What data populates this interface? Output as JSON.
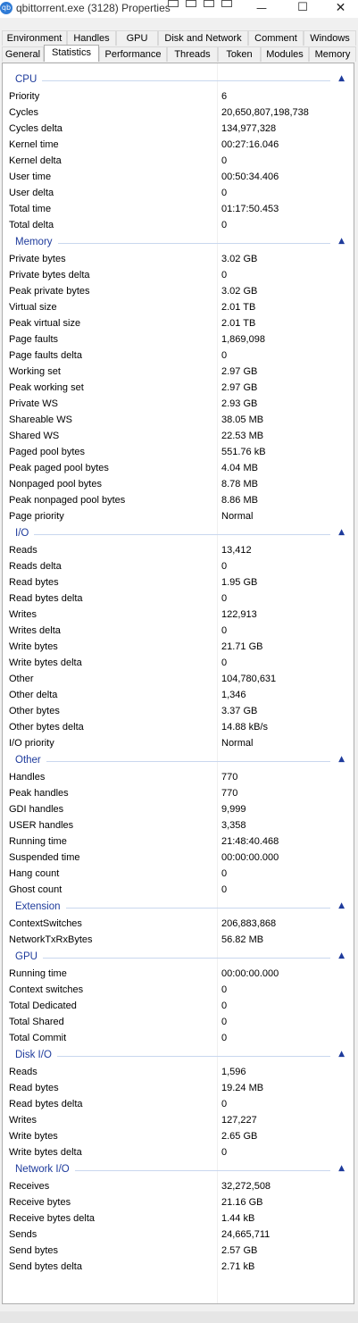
{
  "window": {
    "title": "qbittorrent.exe (3128) Properties",
    "minimize_glyph": "—",
    "maximize_glyph": "☐",
    "close_glyph": "✕"
  },
  "tabs": {
    "row1": [
      "Environment",
      "Handles",
      "GPU",
      "Disk and Network",
      "Comment",
      "Windows"
    ],
    "row2": [
      "General",
      "Statistics",
      "Performance",
      "Threads",
      "Token",
      "Modules",
      "Memory"
    ],
    "active": "Statistics"
  },
  "groups": [
    {
      "title": "CPU",
      "rows": [
        [
          "Priority",
          "6"
        ],
        [
          "Cycles",
          "20,650,807,198,738"
        ],
        [
          "Cycles delta",
          "134,977,328"
        ],
        [
          "Kernel time",
          "00:27:16.046"
        ],
        [
          "Kernel delta",
          "0"
        ],
        [
          "User time",
          "00:50:34.406"
        ],
        [
          "User delta",
          "0"
        ],
        [
          "Total time",
          "01:17:50.453"
        ],
        [
          "Total delta",
          "0"
        ]
      ]
    },
    {
      "title": "Memory",
      "rows": [
        [
          "Private bytes",
          "3.02 GB"
        ],
        [
          "Private bytes delta",
          "0"
        ],
        [
          "Peak private bytes",
          "3.02 GB"
        ],
        [
          "Virtual size",
          "2.01 TB"
        ],
        [
          "Peak virtual size",
          "2.01 TB"
        ],
        [
          "Page faults",
          "1,869,098"
        ],
        [
          "Page faults delta",
          "0"
        ],
        [
          "Working set",
          "2.97 GB"
        ],
        [
          "Peak working set",
          "2.97 GB"
        ],
        [
          "Private WS",
          "2.93 GB"
        ],
        [
          "Shareable WS",
          "38.05 MB"
        ],
        [
          "Shared WS",
          "22.53 MB"
        ],
        [
          "Paged pool bytes",
          "551.76 kB"
        ],
        [
          "Peak paged pool bytes",
          "4.04 MB"
        ],
        [
          "Nonpaged pool bytes",
          "8.78 MB"
        ],
        [
          "Peak nonpaged pool bytes",
          "8.86 MB"
        ],
        [
          "Page priority",
          "Normal"
        ]
      ]
    },
    {
      "title": "I/O",
      "rows": [
        [
          "Reads",
          "13,412"
        ],
        [
          "Reads delta",
          "0"
        ],
        [
          "Read bytes",
          "1.95 GB"
        ],
        [
          "Read bytes delta",
          "0"
        ],
        [
          "Writes",
          "122,913"
        ],
        [
          "Writes delta",
          "0"
        ],
        [
          "Write bytes",
          "21.71 GB"
        ],
        [
          "Write bytes delta",
          "0"
        ],
        [
          "Other",
          "104,780,631"
        ],
        [
          "Other delta",
          "1,346"
        ],
        [
          "Other bytes",
          "3.37 GB"
        ],
        [
          "Other bytes delta",
          "14.88 kB/s"
        ],
        [
          "I/O priority",
          "Normal"
        ]
      ]
    },
    {
      "title": "Other",
      "rows": [
        [
          "Handles",
          "770"
        ],
        [
          "Peak handles",
          "770"
        ],
        [
          "GDI handles",
          "9,999"
        ],
        [
          "USER handles",
          "3,358"
        ],
        [
          "Running time",
          "21:48:40.468"
        ],
        [
          "Suspended time",
          "00:00:00.000"
        ],
        [
          "Hang count",
          "0"
        ],
        [
          "Ghost count",
          "0"
        ]
      ]
    },
    {
      "title": "Extension",
      "rows": [
        [
          "ContextSwitches",
          "206,883,868"
        ],
        [
          "NetworkTxRxBytes",
          "56.82 MB"
        ]
      ]
    },
    {
      "title": "GPU",
      "rows": [
        [
          "Running time",
          "00:00:00.000"
        ],
        [
          "Context switches",
          "0"
        ],
        [
          "Total Dedicated",
          "0"
        ],
        [
          "Total Shared",
          "0"
        ],
        [
          "Total Commit",
          "0"
        ]
      ]
    },
    {
      "title": "Disk I/O",
      "rows": [
        [
          "Reads",
          "1,596"
        ],
        [
          "Read bytes",
          "19.24 MB"
        ],
        [
          "Read bytes delta",
          "0"
        ],
        [
          "Writes",
          "127,227"
        ],
        [
          "Write bytes",
          "2.65 GB"
        ],
        [
          "Write bytes delta",
          "0"
        ]
      ]
    },
    {
      "title": "Network I/O",
      "rows": [
        [
          "Receives",
          "32,272,508"
        ],
        [
          "Receive bytes",
          "21.16 GB"
        ],
        [
          "Receive bytes delta",
          "1.44 kB"
        ],
        [
          "Sends",
          "24,665,711"
        ],
        [
          "Send bytes",
          "2.57 GB"
        ],
        [
          "Send bytes delta",
          "2.71 kB"
        ]
      ]
    }
  ],
  "icons": {
    "app": "qbittorrent-app-icon",
    "collapse": "chevron-up-icon"
  },
  "colors": {
    "group_title": "#1e3b9c",
    "group_line": "#c9d7ee"
  }
}
